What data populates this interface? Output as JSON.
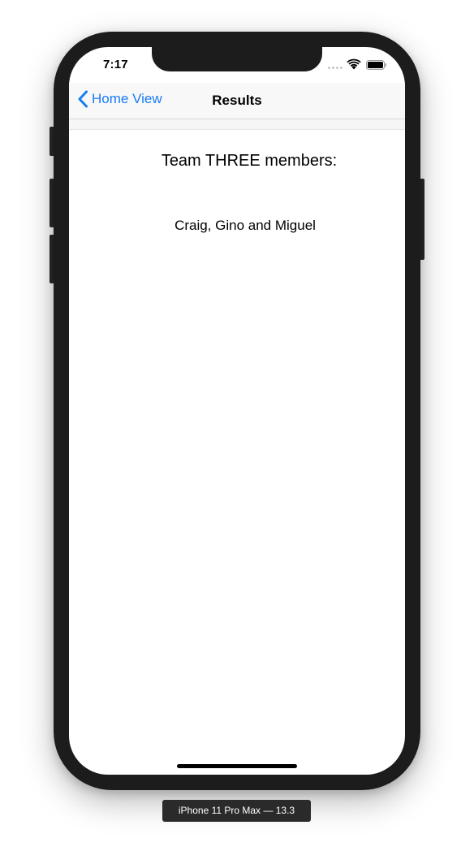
{
  "status_bar": {
    "time": "7:17"
  },
  "nav": {
    "back_label": "Home View",
    "title": "Results"
  },
  "content": {
    "heading": "Team THREE members:",
    "members": "Craig, Gino and Miguel"
  },
  "device": {
    "label": "iPhone 11 Pro Max — 13.3"
  },
  "colors": {
    "accent": "#1a7cf3",
    "bezel": "#1c1c1c"
  },
  "icons": {
    "back": "chevron-left-icon",
    "wifi": "wifi-icon",
    "battery": "battery-icon",
    "signal": "signal-dots-icon"
  }
}
